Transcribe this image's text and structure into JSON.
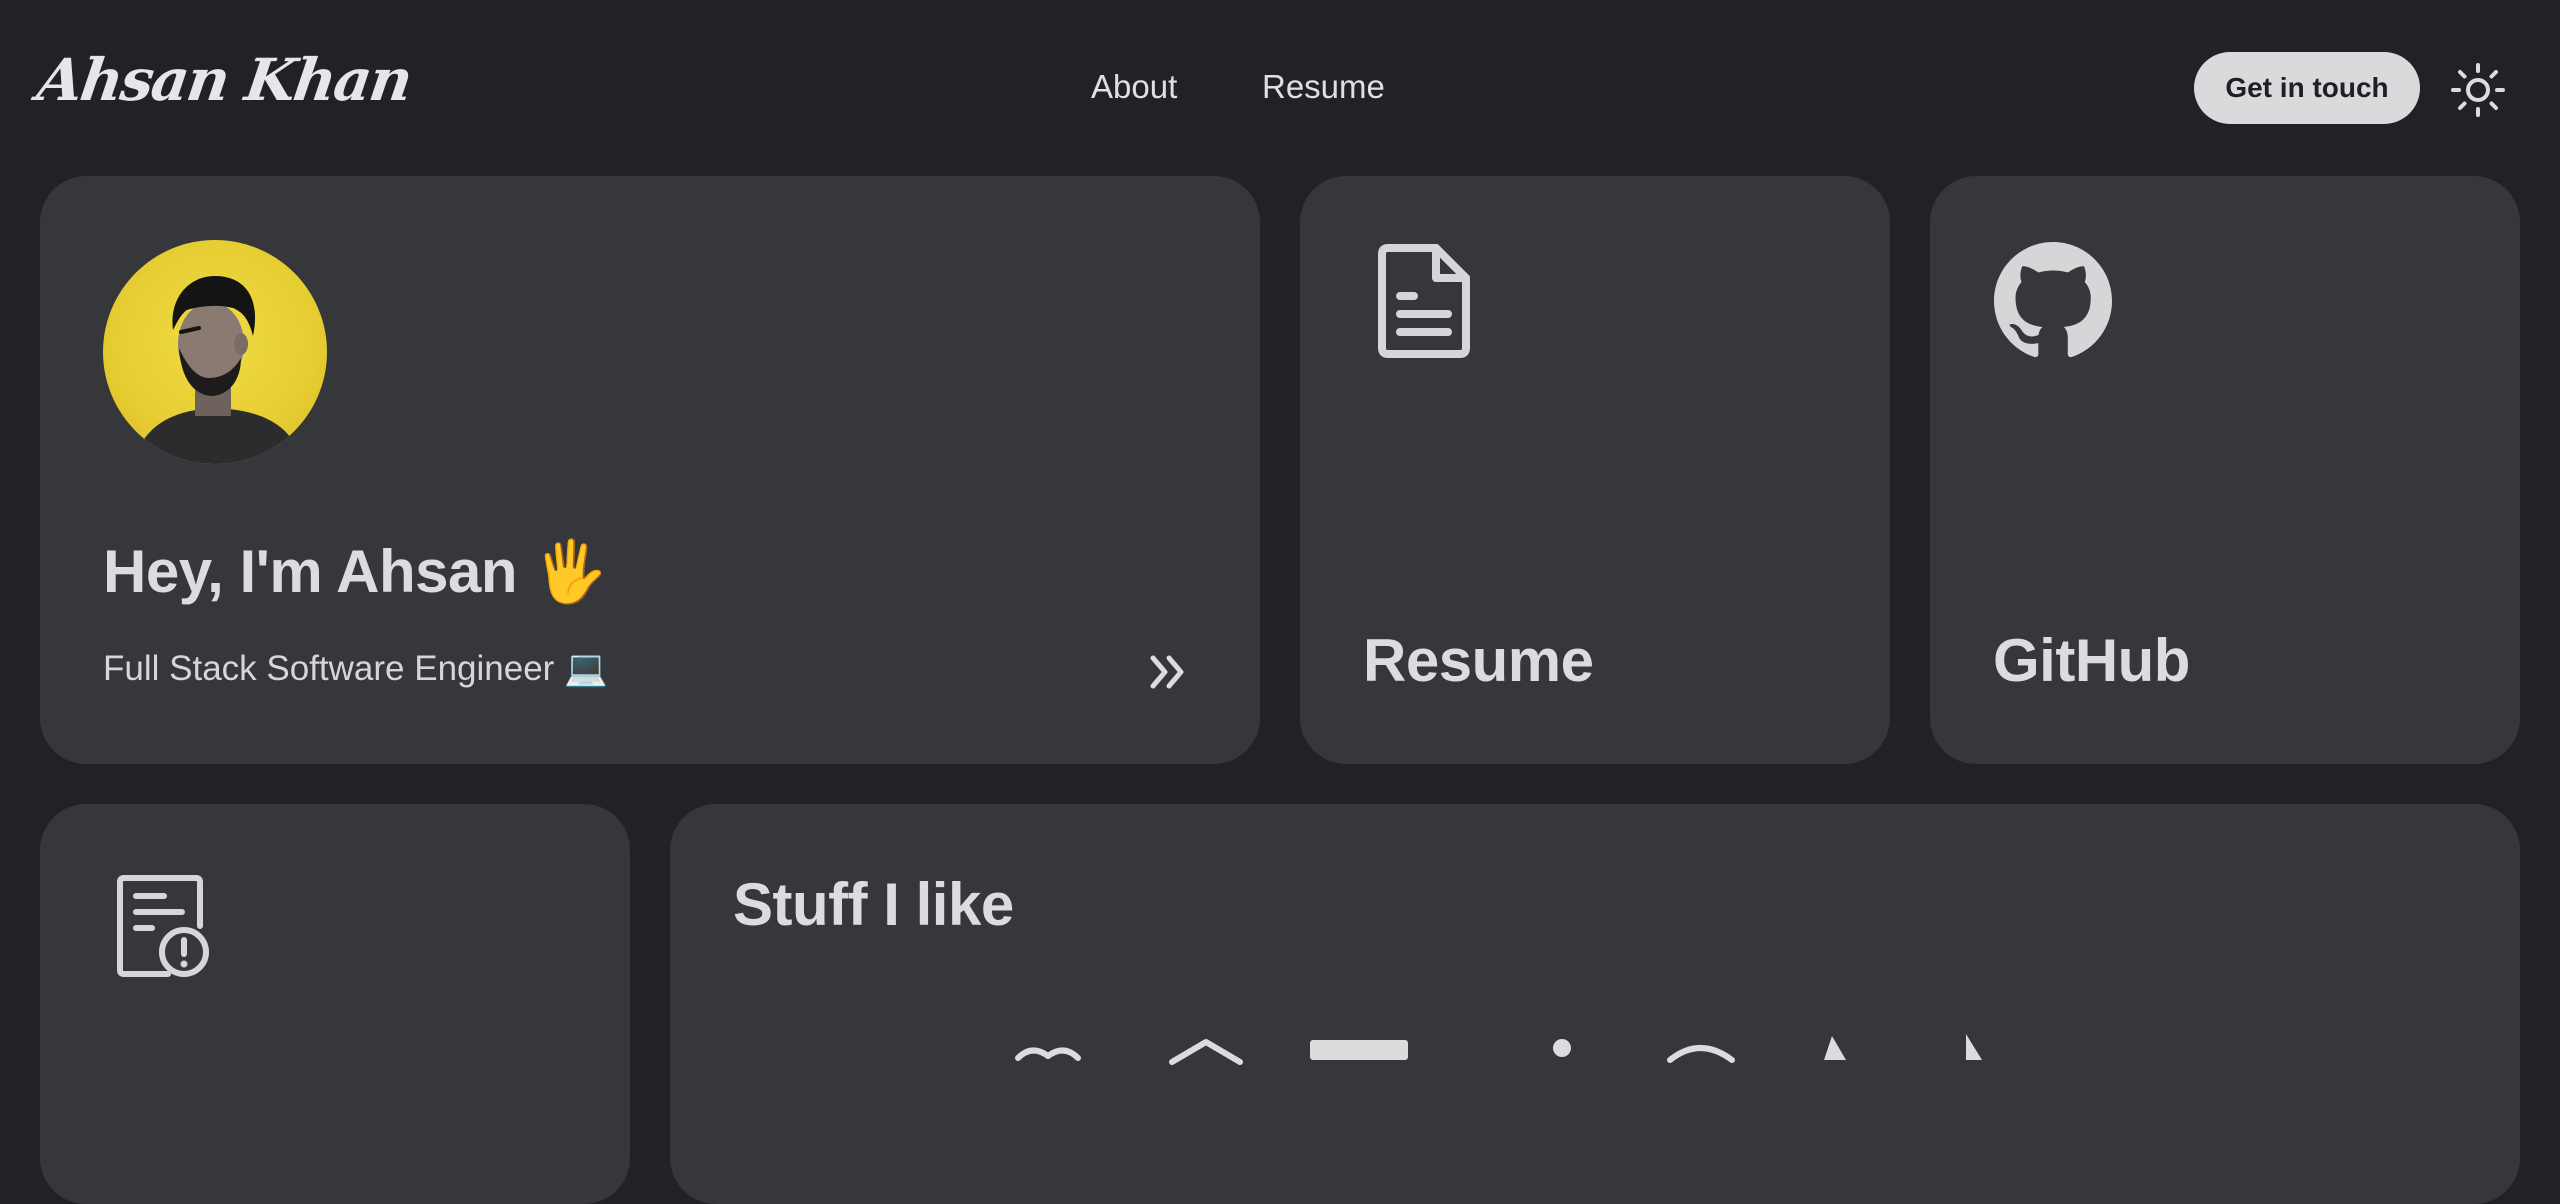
{
  "header": {
    "logo_text": "Ahsan Khan",
    "nav": [
      {
        "label": "About"
      },
      {
        "label": "Resume"
      }
    ],
    "cta_label": "Get in touch",
    "theme_icon": "sun-icon"
  },
  "intro": {
    "avatar": "profile-photo",
    "title": "Hey, I'm Ahsan 🖐",
    "subtitle": "Full Stack Software Engineer 💻",
    "arrow_icon": "double-chevron-right-icon"
  },
  "resume_card": {
    "icon": "document-icon",
    "title": "Resume"
  },
  "github_card": {
    "icon": "github-icon",
    "title": "GitHub"
  },
  "blog_card": {
    "icon": "document-alert-icon"
  },
  "stuff_card": {
    "title": "Stuff I like"
  },
  "colors": {
    "background": "#212225",
    "card": "#36373b",
    "text": "#dcdcde",
    "button": "#dadadd",
    "avatar_bg": "#e8cf35"
  }
}
